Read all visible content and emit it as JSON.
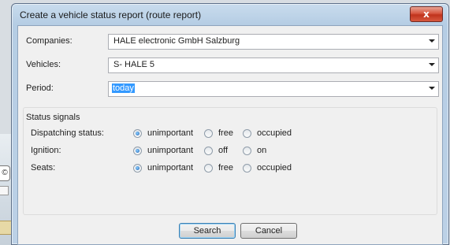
{
  "window": {
    "title": "Create a vehicle status report (route report)",
    "close_label": "x"
  },
  "form": {
    "companies": {
      "label": "Companies:",
      "value": "HALE electronic GmbH Salzburg"
    },
    "vehicles": {
      "label": "Vehicles:",
      "value": "S- HALE 5"
    },
    "period": {
      "label": "Period:",
      "value": "today"
    }
  },
  "status_signals": {
    "title": "Status signals",
    "rows": [
      {
        "label": "Dispatching status:",
        "options": [
          "unimportant",
          "free",
          "occupied"
        ],
        "selected": 0
      },
      {
        "label": "Ignition:",
        "options": [
          "unimportant",
          "off",
          "on"
        ],
        "selected": 0
      },
      {
        "label": "Seats:",
        "options": [
          "unimportant",
          "free",
          "occupied"
        ],
        "selected": 0
      }
    ]
  },
  "buttons": {
    "search": "Search",
    "cancel": "Cancel"
  },
  "background_app": {
    "glyph": "©"
  }
}
